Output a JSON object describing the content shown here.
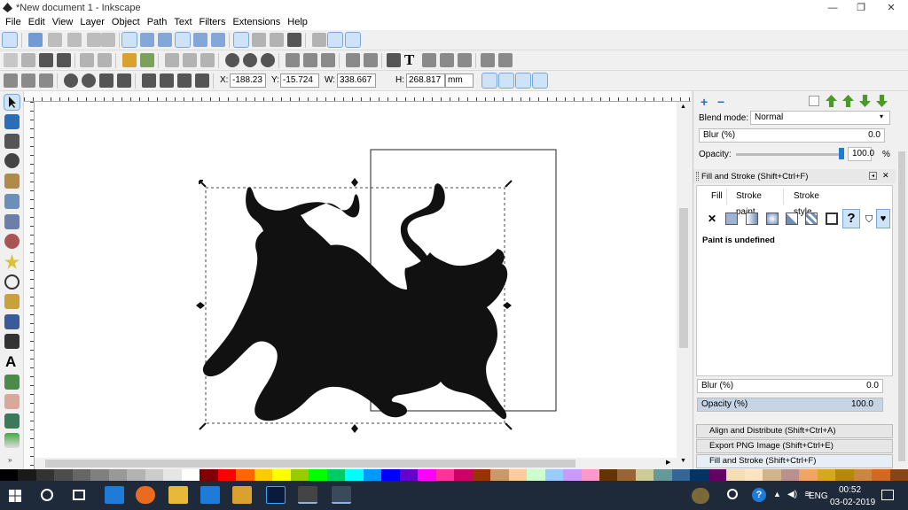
{
  "window": {
    "title": "*New document 1 - Inkscape",
    "minimize": "—",
    "maximize": "❐",
    "close": "✕"
  },
  "menu": [
    "File",
    "Edit",
    "View",
    "Layer",
    "Object",
    "Path",
    "Text",
    "Filters",
    "Extensions",
    "Help"
  ],
  "toolbar": {
    "x_label": "X:",
    "x_value": "-188.23",
    "y_label": "Y:",
    "y_value": "-15.724",
    "w_label": "W:",
    "w_value": "338.667",
    "h_label": "H:",
    "h_value": "268.817",
    "unit": "mm"
  },
  "layers_panel": {
    "blend_label": "Blend mode:",
    "blend_value": "Normal",
    "blur_label": "Blur (%)",
    "blur_value": "0.0",
    "opacity_label": "Opacity:",
    "opacity_value": "100.0",
    "opacity_unit": "%"
  },
  "fill_stroke": {
    "title": "Fill and Stroke (Shift+Ctrl+F)",
    "tab_fill": "Fill",
    "tab_stroke_paint": "Stroke paint",
    "tab_stroke_style": "Stroke style",
    "status": "Paint is undefined",
    "blur_label": "Blur (%)",
    "blur_value": "0.0",
    "opacity_label": "Opacity (%)",
    "opacity_value": "100.0"
  },
  "docked": [
    "Align and Distribute (Shift+Ctrl+A)",
    "Export PNG Image (Shift+Ctrl+E)",
    "Fill and Stroke (Shift+Ctrl+F)"
  ],
  "taskbar": {
    "language": "ENG",
    "time": "00:52",
    "date": "03-02-2019"
  },
  "palette": [
    "#000000",
    "#1a1a1a",
    "#333333",
    "#4d4d4d",
    "#666666",
    "#808080",
    "#999999",
    "#b3b3b3",
    "#cccccc",
    "#e6e6e6",
    "#ffffff",
    "#800000",
    "#ff0000",
    "#ff6600",
    "#ffcc00",
    "#ffff00",
    "#99cc00",
    "#00ff00",
    "#00cc66",
    "#00ffff",
    "#0099ff",
    "#0000ff",
    "#6600cc",
    "#ff00ff",
    "#ff3399",
    "#cc0066",
    "#993300",
    "#cc9966",
    "#ffcc99",
    "#ccffcc",
    "#99ccff",
    "#cc99ff",
    "#ff99cc",
    "#663300",
    "#996633",
    "#cccc99",
    "#669999",
    "#336699",
    "#003366",
    "#660066",
    "#f5deb3",
    "#ffe4c4",
    "#d2b48c",
    "#bc8f8f",
    "#f4a460",
    "#daa520",
    "#b8860b",
    "#cd853f",
    "#d2691e",
    "#8b4513"
  ]
}
